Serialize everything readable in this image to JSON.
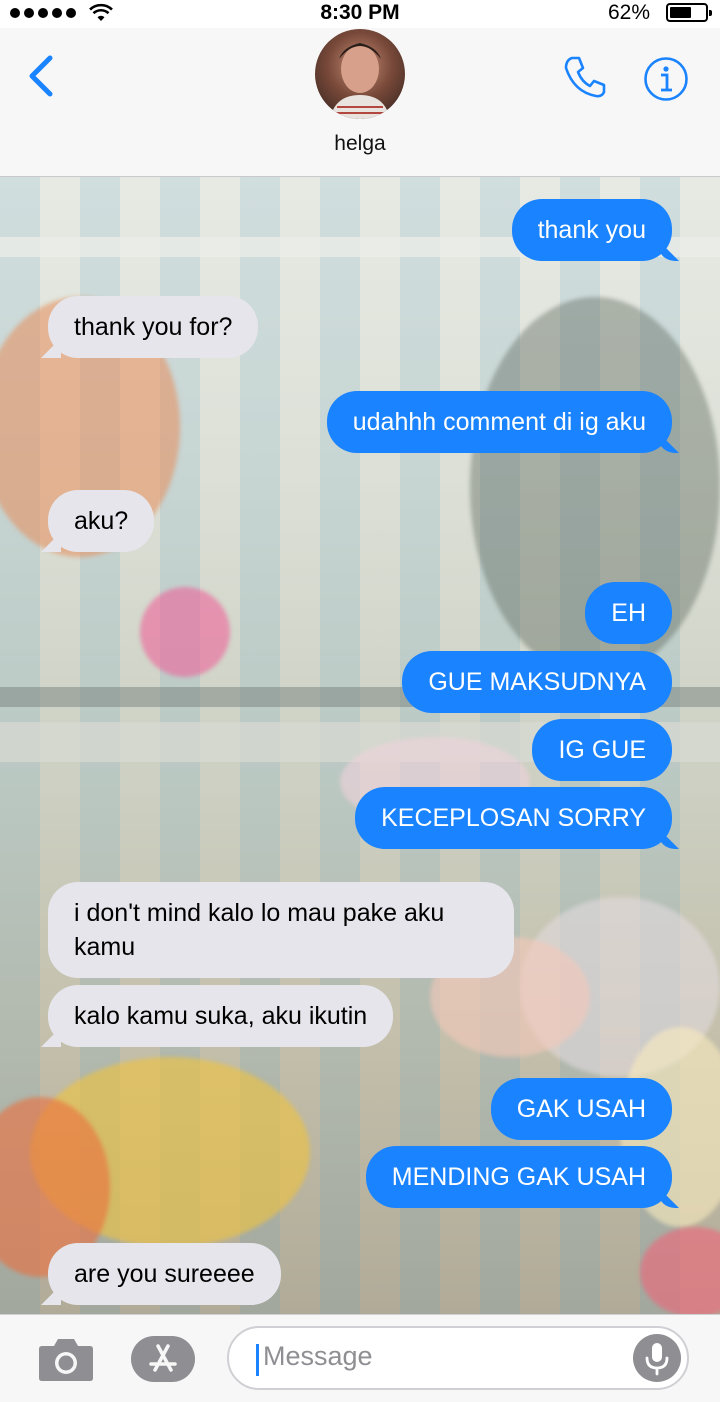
{
  "status_bar": {
    "time": "8:30 PM",
    "battery_text": "62%",
    "battery_level": 0.62
  },
  "header": {
    "contact_name": "helga"
  },
  "messages": [
    {
      "dir": "out",
      "text": "thank you"
    },
    {
      "dir": "in",
      "text": "thank you for?"
    },
    {
      "dir": "out",
      "text": "udahhh comment di ig aku"
    },
    {
      "dir": "in",
      "text": "aku?"
    },
    {
      "dir": "out",
      "text": "EH"
    },
    {
      "dir": "out",
      "text": "GUE MAKSUDNYA"
    },
    {
      "dir": "out",
      "text": "IG GUE"
    },
    {
      "dir": "out",
      "text": "KECEPLOSAN SORRY"
    },
    {
      "dir": "in",
      "text": "i don't mind kalo lo mau pake aku kamu"
    },
    {
      "dir": "in",
      "text": "kalo kamu suka, aku ikutin"
    },
    {
      "dir": "out",
      "text": "GAK USAH"
    },
    {
      "dir": "out",
      "text": "MENDING GAK USAH"
    },
    {
      "dir": "in",
      "text": "are you sureeee"
    }
  ],
  "composer": {
    "placeholder": "Message"
  },
  "colors": {
    "accent": "#1a83ff",
    "incoming_bubble": "#e6e5eb",
    "outgoing_bubble": "#1a83ff"
  },
  "icons": [
    "back-chevron-icon",
    "phone-icon",
    "info-icon",
    "camera-icon",
    "app-store-icon",
    "microphone-icon"
  ]
}
